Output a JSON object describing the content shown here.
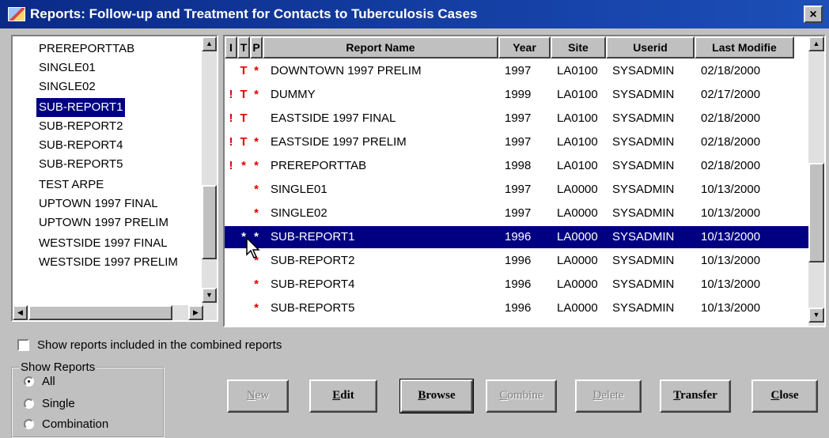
{
  "window": {
    "title": "Reports: Follow-up and Treatment for Contacts to Tuberculosis Cases",
    "close_label": "×"
  },
  "report_list": {
    "items": [
      "PREREPORTTAB",
      "SINGLE01",
      "SINGLE02",
      "SUB-REPORT1",
      "SUB-REPORT2",
      "SUB-REPORT4",
      "SUB-REPORT5",
      "TEST ARPE",
      "UPTOWN 1997 FINAL",
      "UPTOWN 1997 PRELIM",
      "WESTSIDE 1997 FINAL",
      "WESTSIDE 1997 PRELIM"
    ],
    "selected_index": 3
  },
  "grid": {
    "columns": [
      "I",
      "T",
      "P",
      "Report Name",
      "Year",
      "Site",
      "Userid",
      "Last Modifie"
    ],
    "rows": [
      {
        "i": "",
        "t": "T",
        "p": "*",
        "name": "DOWNTOWN 1997 PRELIM",
        "year": "1997",
        "site": "LA0100",
        "userid": "SYSADMIN",
        "modified": "02/18/2000"
      },
      {
        "i": "!",
        "t": "T",
        "p": "*",
        "name": "DUMMY",
        "year": "1999",
        "site": "LA0100",
        "userid": "SYSADMIN",
        "modified": "02/17/2000"
      },
      {
        "i": "!",
        "t": "T",
        "p": "",
        "name": "EASTSIDE 1997 FINAL",
        "year": "1997",
        "site": "LA0100",
        "userid": "SYSADMIN",
        "modified": "02/18/2000"
      },
      {
        "i": "!",
        "t": "T",
        "p": "*",
        "name": "EASTSIDE 1997 PRELIM",
        "year": "1997",
        "site": "LA0100",
        "userid": "SYSADMIN",
        "modified": "02/18/2000"
      },
      {
        "i": "!",
        "t": "*",
        "p": "*",
        "name": "PREREPORTTAB",
        "year": "1998",
        "site": "LA0100",
        "userid": "SYSADMIN",
        "modified": "02/18/2000"
      },
      {
        "i": "",
        "t": "",
        "p": "*",
        "name": "SINGLE01",
        "year": "1997",
        "site": "LA0000",
        "userid": "SYSADMIN",
        "modified": "10/13/2000"
      },
      {
        "i": "",
        "t": "",
        "p": "*",
        "name": "SINGLE02",
        "year": "1997",
        "site": "LA0000",
        "userid": "SYSADMIN",
        "modified": "10/13/2000"
      },
      {
        "i": "",
        "t": "*",
        "p": "*",
        "name": "SUB-REPORT1",
        "year": "1996",
        "site": "LA0000",
        "userid": "SYSADMIN",
        "modified": "10/13/2000"
      },
      {
        "i": "",
        "t": "",
        "p": "*",
        "name": "SUB-REPORT2",
        "year": "1996",
        "site": "LA0000",
        "userid": "SYSADMIN",
        "modified": "10/13/2000"
      },
      {
        "i": "",
        "t": "",
        "p": "*",
        "name": "SUB-REPORT4",
        "year": "1996",
        "site": "LA0000",
        "userid": "SYSADMIN",
        "modified": "10/13/2000"
      },
      {
        "i": "",
        "t": "",
        "p": "*",
        "name": "SUB-REPORT5",
        "year": "1996",
        "site": "LA0000",
        "userid": "SYSADMIN",
        "modified": "10/13/2000"
      }
    ],
    "selected_index": 7
  },
  "options": {
    "show_combined_label": "Show reports included in the combined reports",
    "show_combined_checked": false,
    "show_reports_legend": "Show Reports",
    "radios": [
      {
        "label": "All",
        "checked": true
      },
      {
        "label": "Single",
        "checked": false
      },
      {
        "label": "Combination",
        "checked": false
      }
    ]
  },
  "buttons": {
    "new": {
      "mnemonic": "N",
      "rest": "ew",
      "enabled": false
    },
    "edit": {
      "mnemonic": "E",
      "rest": "dit",
      "enabled": true
    },
    "browse": {
      "mnemonic": "B",
      "rest": "rowse",
      "enabled": true
    },
    "combine": {
      "mnemonic": "C",
      "rest": "ombine",
      "enabled": false
    },
    "delete": {
      "mnemonic": "D",
      "rest": "elete",
      "enabled": false
    },
    "transfer": {
      "mnemonic": "T",
      "rest": "ransfer",
      "enabled": true
    },
    "close": {
      "mnemonic": "C",
      "rest": "lose",
      "enabled": true
    }
  },
  "icons": {
    "app": "report-app-icon",
    "window_close": "close-icon",
    "scroll_up": "arrow-up-icon",
    "scroll_down": "arrow-down-icon",
    "scroll_left": "arrow-left-icon",
    "scroll_right": "arrow-right-icon",
    "pointer": "mouse-pointer-icon"
  },
  "colors": {
    "titlebar": "#0a2a88",
    "selection": "#000080",
    "flag": "#e00000",
    "face": "#c0c0c0"
  }
}
